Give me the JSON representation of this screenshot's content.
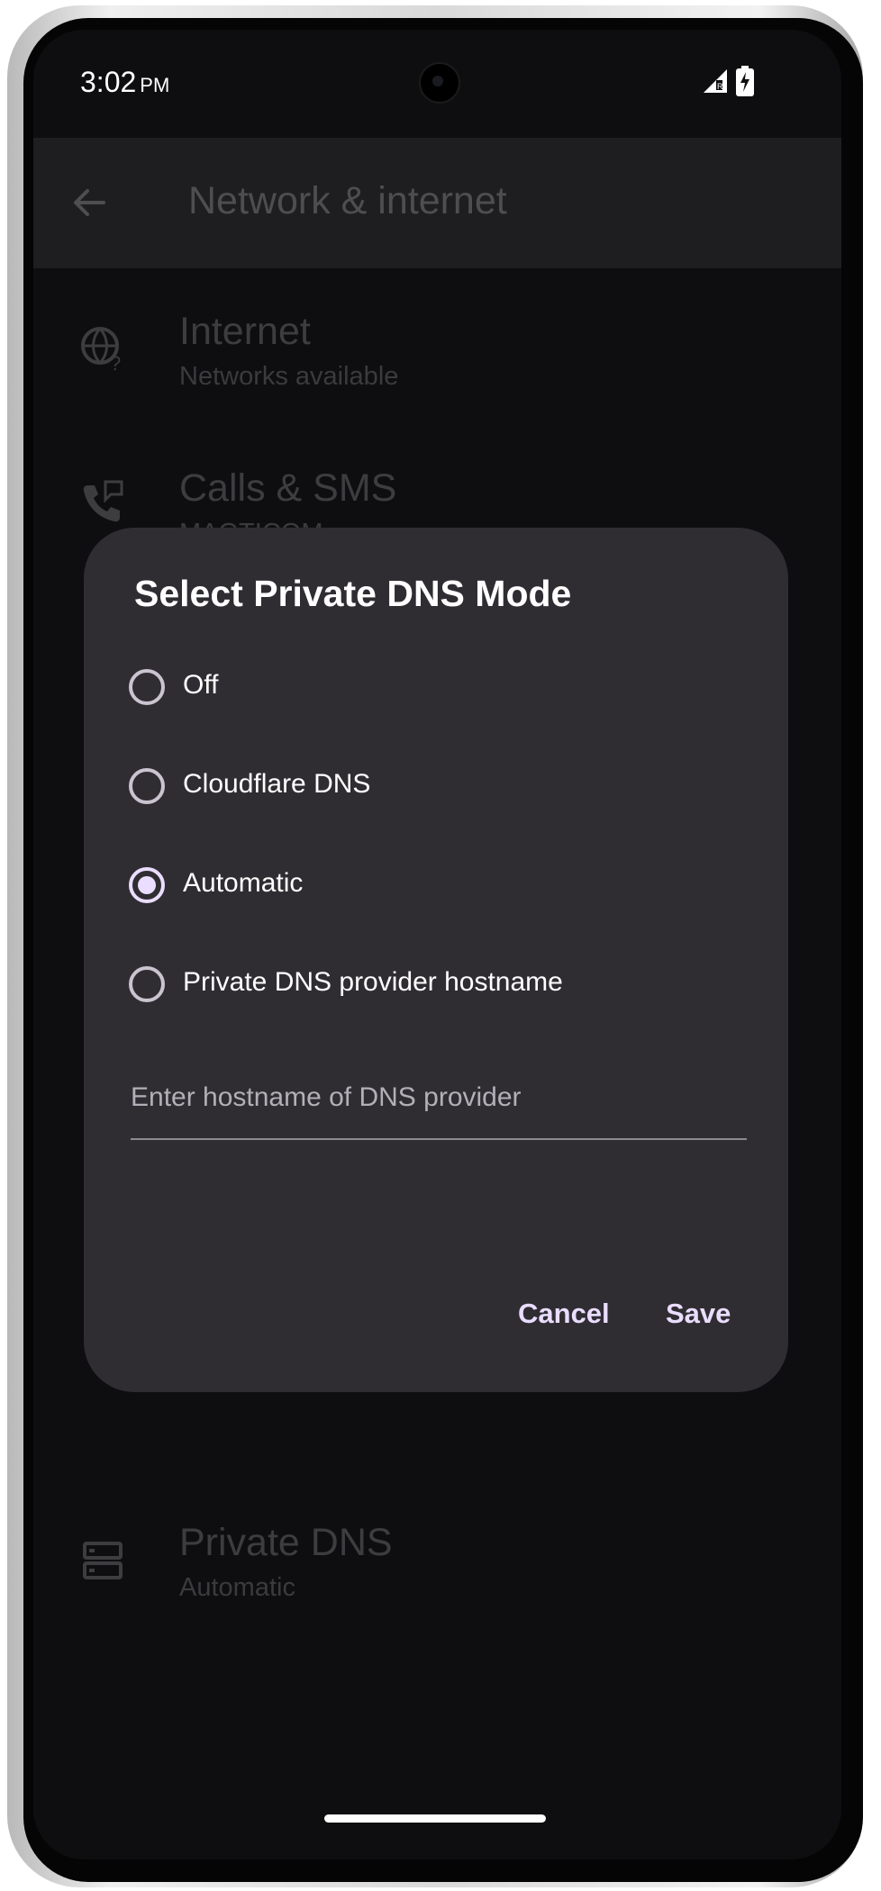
{
  "status_bar": {
    "time": "3:02",
    "ampm": "PM",
    "signal_icon": "signal-icon",
    "battery_icon": "battery-charging-icon"
  },
  "app_bar": {
    "back_icon": "back-arrow-icon",
    "title": "Network & internet"
  },
  "settings_list": [
    {
      "icon": "globe-question-icon",
      "title": "Internet",
      "subtitle": "Networks available"
    },
    {
      "icon": "phone-message-icon",
      "title": "Calls & SMS",
      "subtitle": "MAGTICOM"
    },
    {
      "icon": "dns-icon",
      "title": "Private DNS",
      "subtitle": "Automatic"
    }
  ],
  "dialog": {
    "title": "Select Private DNS Mode",
    "options": [
      {
        "label": "Off",
        "selected": false
      },
      {
        "label": "Cloudflare DNS",
        "selected": false
      },
      {
        "label": "Automatic",
        "selected": true
      },
      {
        "label": "Private DNS provider hostname",
        "selected": false
      }
    ],
    "hostname_input": {
      "value": "",
      "placeholder": "Enter hostname of DNS provider"
    },
    "cancel_label": "Cancel",
    "save_label": "Save"
  },
  "colors": {
    "accent": "#eaddff",
    "dialog_bg": "#2f2d32",
    "screen_bg": "#0e0e10"
  }
}
